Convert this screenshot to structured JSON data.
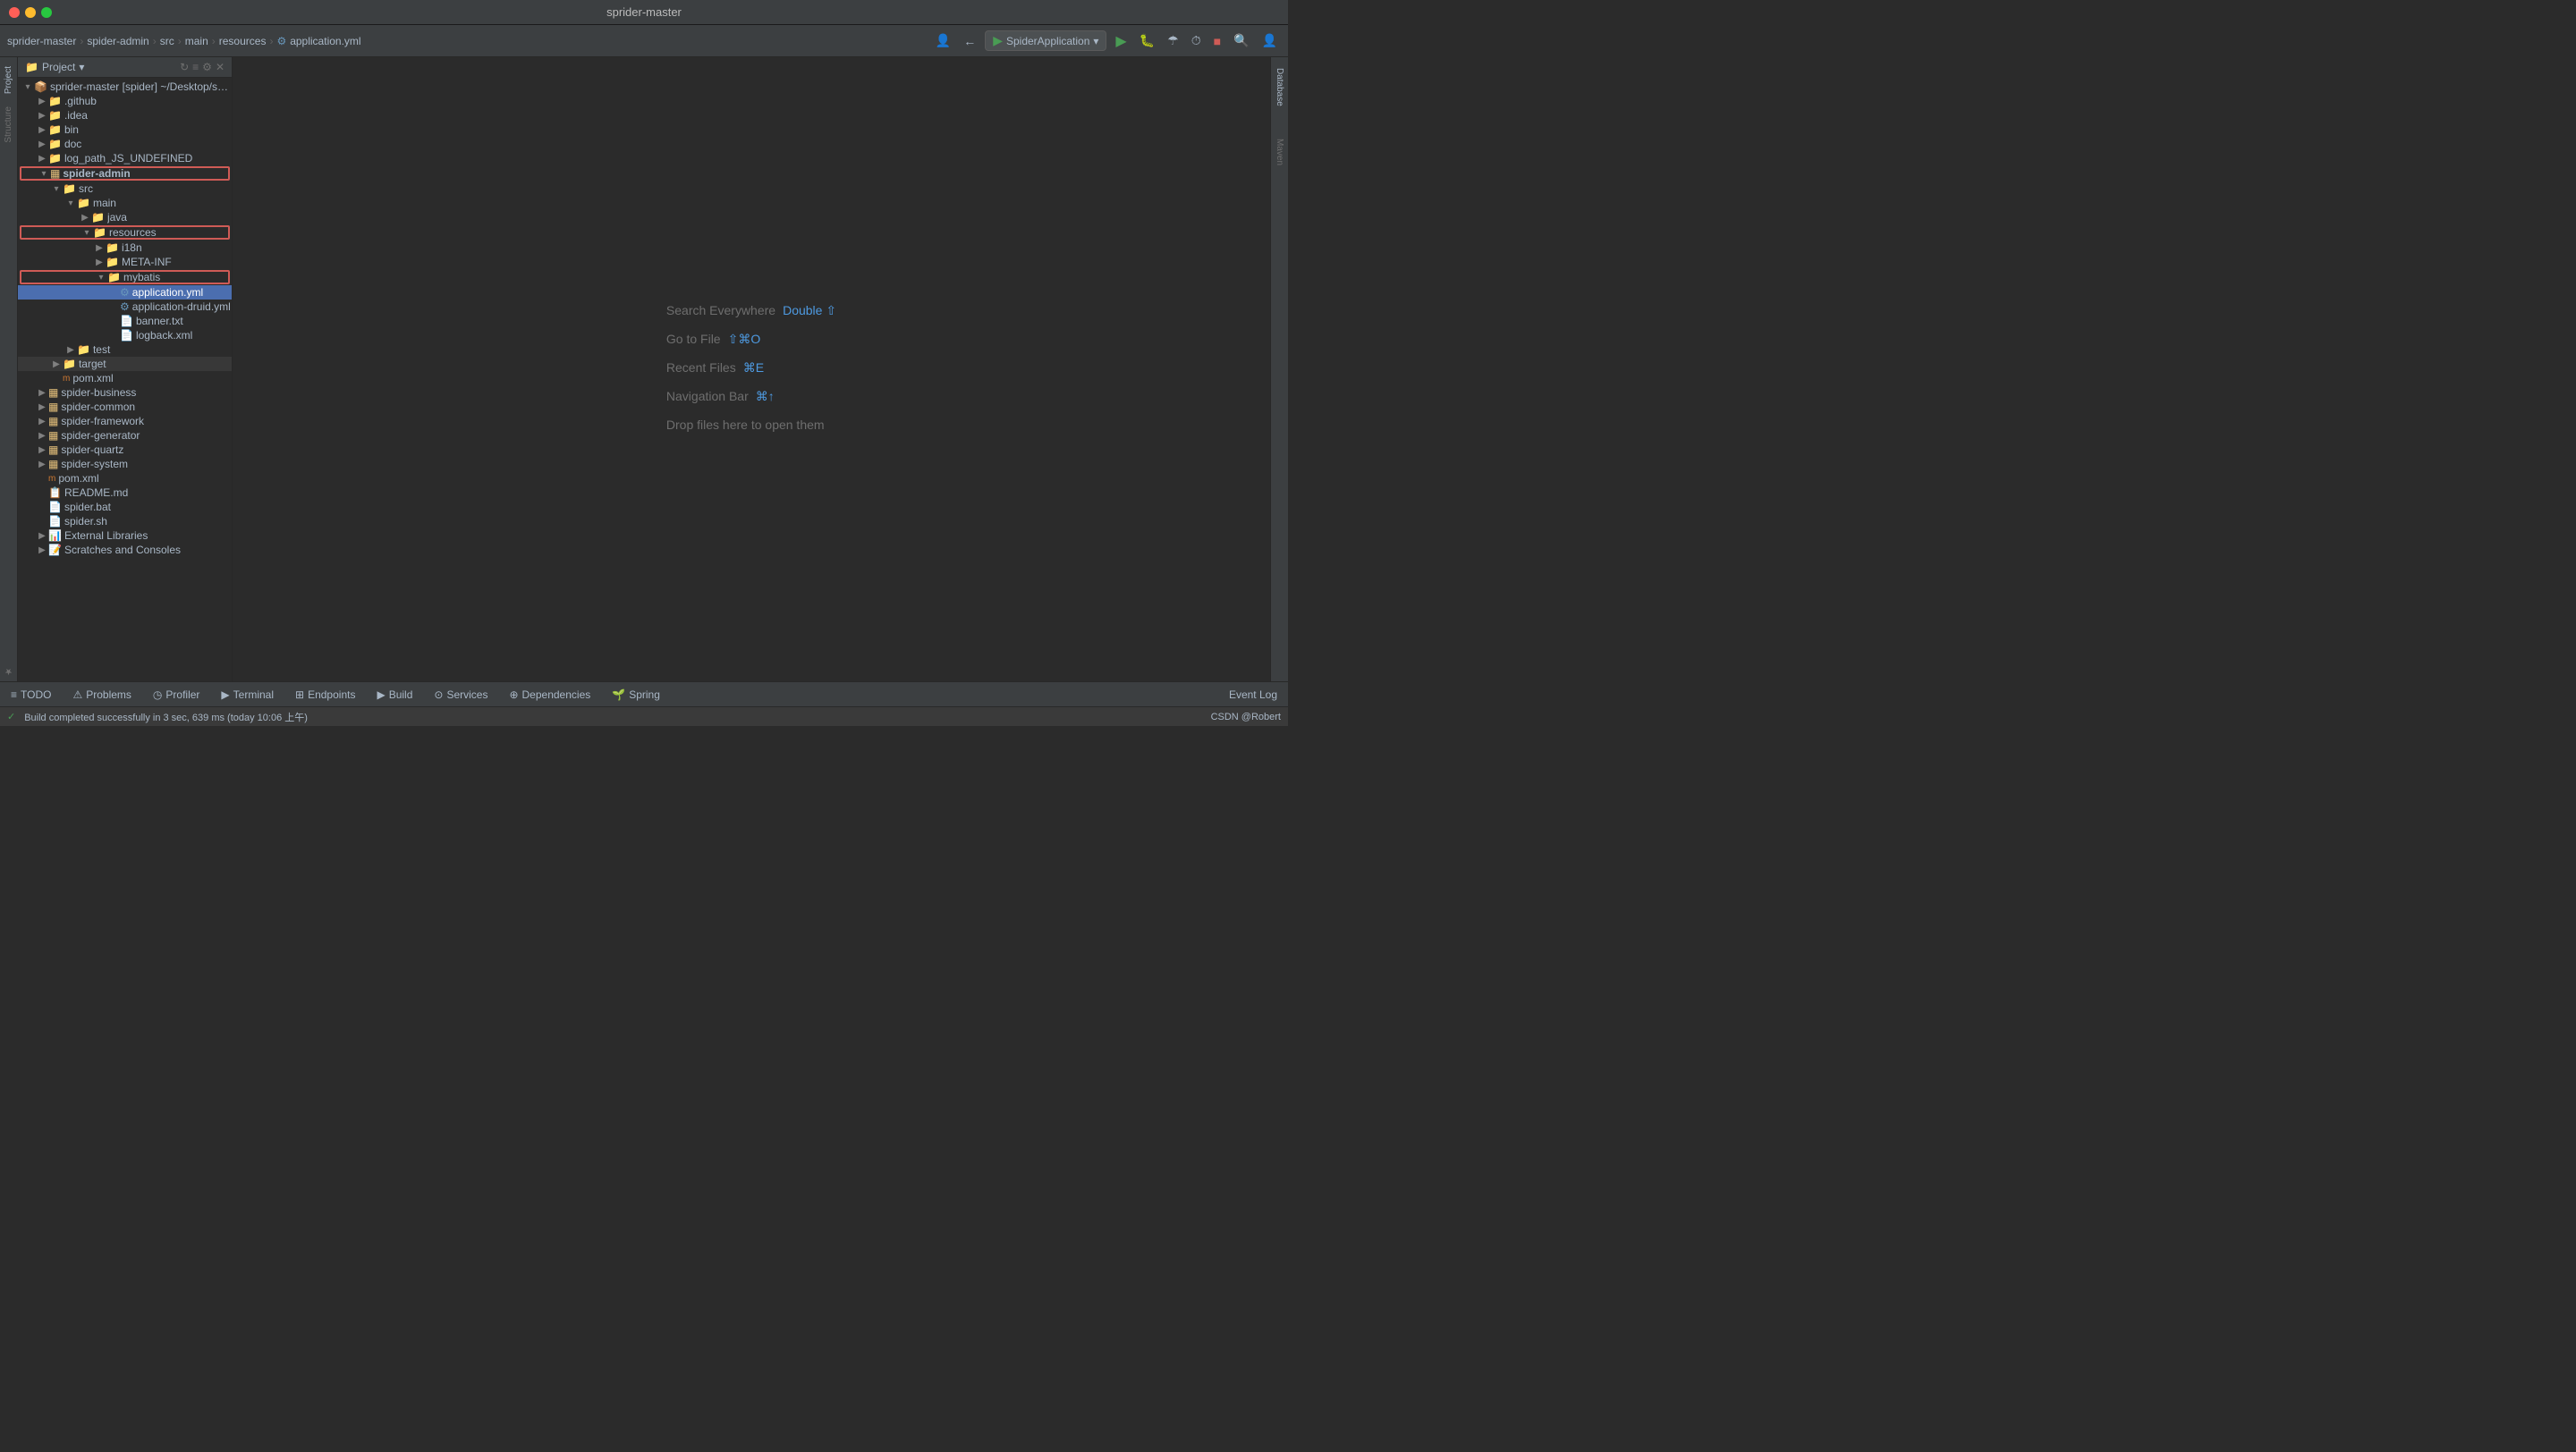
{
  "titlebar": {
    "title": "sprider-master"
  },
  "navbar": {
    "breadcrumbs": [
      {
        "label": "sprider-master",
        "sep": true
      },
      {
        "label": "spider-admin",
        "sep": true
      },
      {
        "label": "src",
        "sep": true
      },
      {
        "label": "main",
        "sep": true
      },
      {
        "label": "resources",
        "sep": true
      },
      {
        "label": "application.yml",
        "sep": false
      }
    ],
    "run_config": "SpiderApplication",
    "run_config_arrow": "▾"
  },
  "project_panel": {
    "title": "Project",
    "root": {
      "label": "sprider-master [spider]",
      "path": "~/Desktop/sprider-master"
    },
    "tree_items": [
      {
        "id": "github",
        "indent": 1,
        "expanded": false,
        "label": ".github",
        "type": "folder"
      },
      {
        "id": "idea",
        "indent": 1,
        "expanded": false,
        "label": ".idea",
        "type": "folder"
      },
      {
        "id": "bin",
        "indent": 1,
        "expanded": false,
        "label": "bin",
        "type": "folder"
      },
      {
        "id": "doc",
        "indent": 1,
        "expanded": false,
        "label": "doc",
        "type": "folder"
      },
      {
        "id": "log_path",
        "indent": 1,
        "expanded": false,
        "label": "log_path_JS_UNDEFINED",
        "type": "folder"
      },
      {
        "id": "spider-admin",
        "indent": 1,
        "expanded": true,
        "label": "spider-admin",
        "type": "module",
        "highlighted": true
      },
      {
        "id": "src",
        "indent": 2,
        "expanded": true,
        "label": "src",
        "type": "folder"
      },
      {
        "id": "main",
        "indent": 3,
        "expanded": true,
        "label": "main",
        "type": "folder"
      },
      {
        "id": "java",
        "indent": 4,
        "expanded": false,
        "label": "java",
        "type": "folder"
      },
      {
        "id": "resources",
        "indent": 4,
        "expanded": true,
        "label": "resources",
        "type": "folder",
        "highlighted": true
      },
      {
        "id": "i18n",
        "indent": 5,
        "expanded": false,
        "label": "i18n",
        "type": "folder"
      },
      {
        "id": "META-INF",
        "indent": 5,
        "expanded": false,
        "label": "META-INF",
        "type": "folder"
      },
      {
        "id": "mybatis",
        "indent": 5,
        "expanded": true,
        "label": "mybatis",
        "type": "folder",
        "outlined": true
      },
      {
        "id": "application.yml",
        "indent": 6,
        "expanded": false,
        "label": "application.yml",
        "type": "yaml",
        "selected": true
      },
      {
        "id": "application-druid.yml",
        "indent": 6,
        "expanded": false,
        "label": "application-druid.yml",
        "type": "yaml"
      },
      {
        "id": "banner.txt",
        "indent": 6,
        "expanded": false,
        "label": "banner.txt",
        "type": "txt"
      },
      {
        "id": "logback.xml",
        "indent": 6,
        "expanded": false,
        "label": "logback.xml",
        "type": "xml"
      },
      {
        "id": "test",
        "indent": 3,
        "expanded": false,
        "label": "test",
        "type": "folder"
      },
      {
        "id": "target",
        "indent": 2,
        "expanded": false,
        "label": "target",
        "type": "folder"
      },
      {
        "id": "pom_admin",
        "indent": 2,
        "expanded": false,
        "label": "pom.xml",
        "type": "xml"
      },
      {
        "id": "spider-business",
        "indent": 1,
        "expanded": false,
        "label": "spider-business",
        "type": "module"
      },
      {
        "id": "spider-common",
        "indent": 1,
        "expanded": false,
        "label": "spider-common",
        "type": "module"
      },
      {
        "id": "spider-framework",
        "indent": 1,
        "expanded": false,
        "label": "spider-framework",
        "type": "module"
      },
      {
        "id": "spider-generator",
        "indent": 1,
        "expanded": false,
        "label": "spider-generator",
        "type": "module"
      },
      {
        "id": "spider-quartz",
        "indent": 1,
        "expanded": false,
        "label": "spider-quartz",
        "type": "module"
      },
      {
        "id": "spider-system",
        "indent": 1,
        "expanded": false,
        "label": "spider-system",
        "type": "module"
      },
      {
        "id": "pom_root",
        "indent": 1,
        "expanded": false,
        "label": "pom.xml",
        "type": "xml"
      },
      {
        "id": "readme",
        "indent": 1,
        "expanded": false,
        "label": "README.md",
        "type": "md"
      },
      {
        "id": "spider_bat",
        "indent": 1,
        "expanded": false,
        "label": "spider.bat",
        "type": "bat"
      },
      {
        "id": "spider_sh",
        "indent": 1,
        "expanded": false,
        "label": "spider.sh",
        "type": "sh"
      },
      {
        "id": "ext_libs",
        "indent": 1,
        "expanded": false,
        "label": "External Libraries",
        "type": "library"
      },
      {
        "id": "scratches",
        "indent": 1,
        "expanded": false,
        "label": "Scratches and Consoles",
        "type": "scratches"
      }
    ]
  },
  "editor": {
    "shortcuts": [
      {
        "label": "Search Everywhere",
        "key": "Double ⇧"
      },
      {
        "label": "Go to File",
        "key": "⇧⌘O"
      },
      {
        "label": "Recent Files",
        "key": "⌘E"
      },
      {
        "label": "Navigation Bar",
        "key": "⌘↑"
      },
      {
        "label": "Drop files here to open them",
        "key": ""
      }
    ]
  },
  "right_panels": [
    {
      "label": "Database"
    },
    {
      "label": "Maven"
    }
  ],
  "bottom_toolbar": {
    "items": [
      {
        "icon": "≡",
        "label": "TODO"
      },
      {
        "icon": "⚠",
        "label": "Problems"
      },
      {
        "icon": "◷",
        "label": "Profiler"
      },
      {
        "icon": "▶",
        "label": "Terminal"
      },
      {
        "icon": "⊞",
        "label": "Endpoints"
      },
      {
        "icon": "▶",
        "label": "Build"
      },
      {
        "icon": "⊙",
        "label": "Services"
      },
      {
        "icon": "⊕",
        "label": "Dependencies"
      },
      {
        "icon": "🌱",
        "label": "Spring"
      }
    ],
    "right_item": {
      "label": "Event Log"
    }
  },
  "status_bar": {
    "message": "Build completed successfully in 3 sec, 639 ms (today 10:06 上午)",
    "right_text": "CSDN @Robert"
  },
  "sidebar_left": [
    {
      "label": "Project"
    },
    {
      "label": "Structure"
    },
    {
      "label": "Favorites"
    }
  ]
}
